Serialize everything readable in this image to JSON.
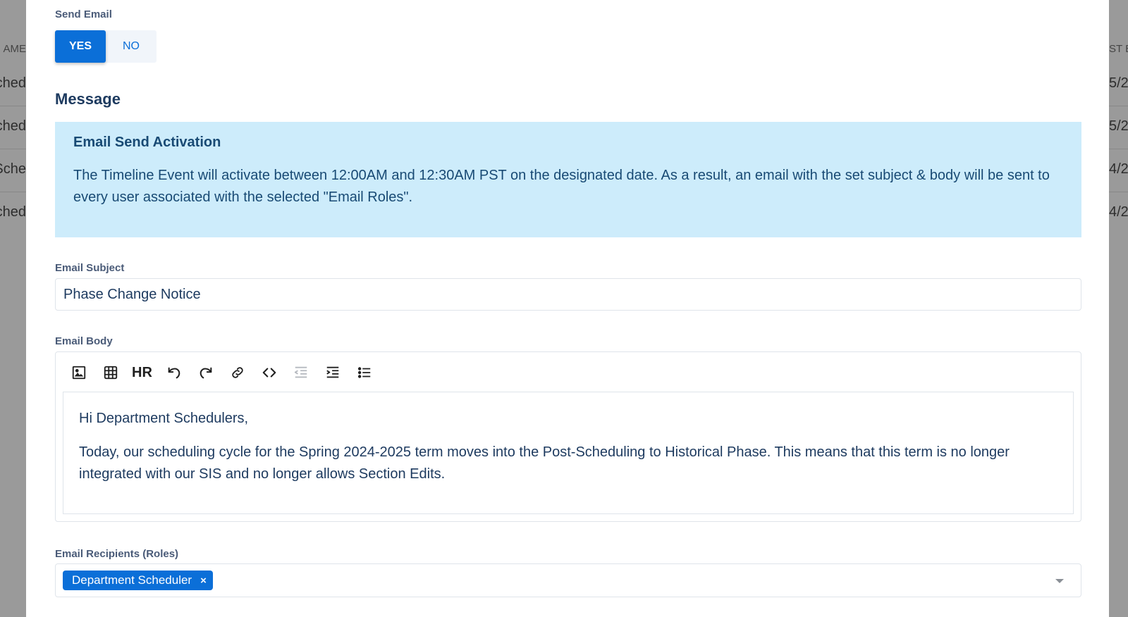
{
  "background": {
    "left_header": "AME",
    "left_rows": [
      "ched",
      "ched",
      "Sche",
      "ched"
    ],
    "right_header": "ST E",
    "right_rows": [
      "5/2",
      "5/2",
      "4/2",
      "4/2"
    ]
  },
  "send_email": {
    "label": "Send Email",
    "yes_label": "YES",
    "no_label": "NO",
    "selected": "YES"
  },
  "message": {
    "title": "Message",
    "info_title": "Email Send Activation",
    "info_text": "The Timeline Event will activate between 12:00AM and 12:30AM PST on the designated date. As a result, an email with the set subject & body will be sent to every user associated with the selected \"Email Roles\"."
  },
  "email_subject": {
    "label": "Email Subject",
    "value": "Phase Change Notice"
  },
  "email_body": {
    "label": "Email Body",
    "toolbar": {
      "image_icon": "image-icon",
      "table_icon": "table-icon",
      "hr_label": "HR",
      "undo_icon": "undo-icon",
      "redo_icon": "redo-icon",
      "link_icon": "link-icon",
      "code_icon": "code-icon",
      "outdent_icon": "outdent-icon",
      "indent_icon": "indent-icon",
      "bullet_list_icon": "bullet-list-icon"
    },
    "paragraphs": [
      "Hi Department Schedulers,",
      "Today, our scheduling cycle for the Spring 2024-2025 term moves into the Post-Scheduling to Historical Phase. This means that this term is no longer integrated with our SIS and no longer allows Section Edits."
    ]
  },
  "email_recipients": {
    "label": "Email Recipients (Roles)",
    "tags": [
      "Department Scheduler"
    ],
    "remove_glyph": "×"
  },
  "colors": {
    "primary": "#0b6fd8",
    "info_bg": "#cdecfb",
    "label": "#4a5b78",
    "text": "#1d3a5f"
  }
}
